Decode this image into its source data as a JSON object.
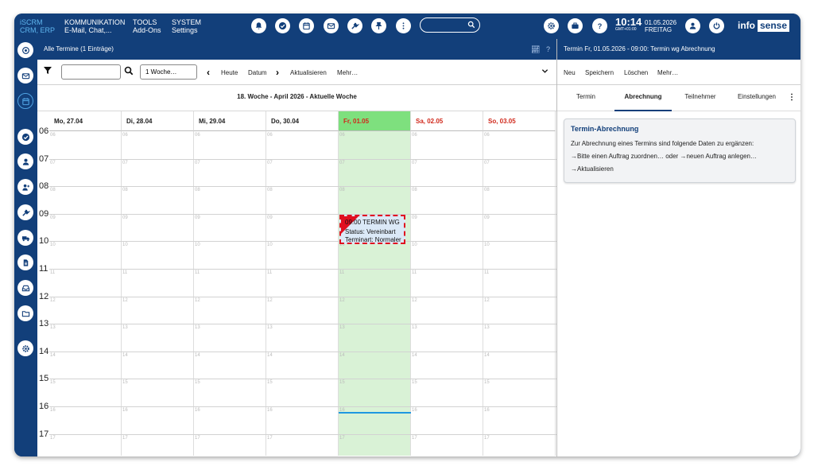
{
  "brand": {
    "line1": "iSCRM",
    "line2": "CRM, ERP"
  },
  "menu": [
    {
      "title": "KOMMUNIKATION",
      "sub": "E-Mail, Chat,..."
    },
    {
      "title": "TOOLS",
      "sub": "Add-Ons"
    },
    {
      "title": "SYSTEM",
      "sub": "Settings"
    }
  ],
  "clock": {
    "time": "10:14",
    "tz": "GMT+01:00",
    "date": "01.05.2026",
    "weekday": "FREITAG"
  },
  "logo": {
    "part1": "info",
    "part2": "sense"
  },
  "main": {
    "title": "Alle Termine (1 Einträge)",
    "toolbar": {
      "range": "1 Woche…",
      "today": "Heute",
      "date": "Datum",
      "refresh": "Aktualisieren",
      "more": "Mehr…"
    },
    "week_title": "18. Woche  -  April 2026  -  Aktuelle Woche",
    "days": [
      {
        "label": "Mo, 27.04"
      },
      {
        "label": "Di, 28.04"
      },
      {
        "label": "Mi, 29.04"
      },
      {
        "label": "Do, 30.04"
      },
      {
        "label": "Fr, 01.05"
      },
      {
        "label": "Sa, 02.05"
      },
      {
        "label": "So, 03.05"
      }
    ],
    "hours": [
      "06",
      "07",
      "08",
      "09",
      "10",
      "11",
      "12",
      "13",
      "14",
      "15",
      "16",
      "17"
    ],
    "event": {
      "line1": "09:00  TERMIN WG",
      "line2": "Status: Vereinbart",
      "line3": "Terminart: Normaler"
    }
  },
  "right": {
    "title": "Termin Fr, 01.05.2026 - 09:00: Termin wg Abrechnung",
    "toolbar": {
      "new": "Neu",
      "save": "Speichern",
      "delete": "Löschen",
      "more": "Mehr…"
    },
    "tabs": [
      "Termin",
      "Abrechnung",
      "Teilnehmer",
      "Einstellungen"
    ],
    "card": {
      "title": "Termin-Abrechnung",
      "intro": "Zur Abrechnung eines Termins sind folgende Daten zu ergänzen:",
      "link1": "→Bitte einen Auftrag zuordnen…",
      "or": "oder",
      "link2": "→neuen Auftrag anlegen…",
      "link3": "→Aktualisieren"
    }
  },
  "colors": {
    "navy": "#123f7a",
    "today": "#7ee07e",
    "weekend": "#d0281b",
    "event_border": "#e01020"
  }
}
